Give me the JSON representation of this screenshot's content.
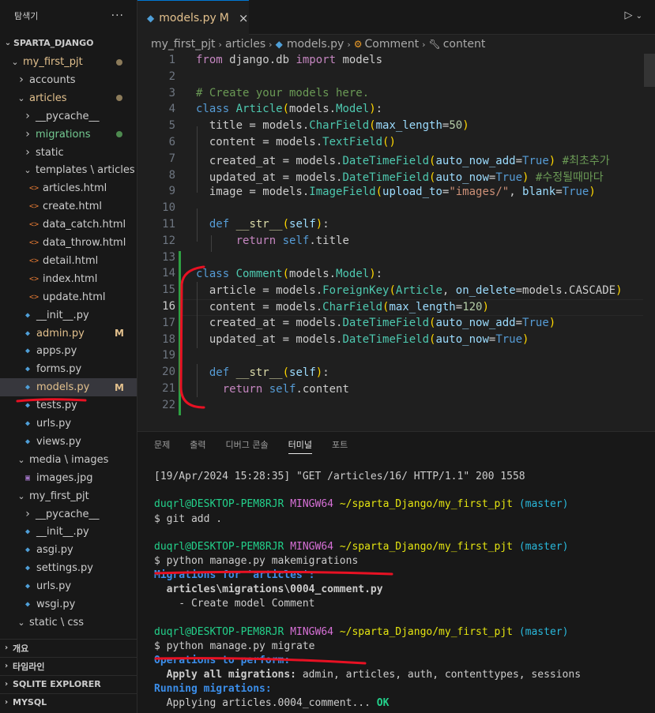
{
  "explorer": {
    "title": "탐색기",
    "more_icon": "ellipsis-icon",
    "project": "SPARTA_DJANGO",
    "items": [
      {
        "label": "my_first_pjt",
        "kind": "folder-open",
        "dot": "modified"
      },
      {
        "label": "accounts",
        "kind": "folder-closed"
      },
      {
        "label": "articles",
        "kind": "folder-open",
        "dot": "modified"
      },
      {
        "label": "__pycache__",
        "kind": "folder-closed"
      },
      {
        "label": "migrations",
        "kind": "folder-closed",
        "dot": "untracked"
      },
      {
        "label": "static",
        "kind": "folder-closed"
      },
      {
        "label": "templates \\ articles",
        "kind": "folder-open"
      },
      {
        "label": "articles.html",
        "kind": "html"
      },
      {
        "label": "create.html",
        "kind": "html"
      },
      {
        "label": "data_catch.html",
        "kind": "html"
      },
      {
        "label": "data_throw.html",
        "kind": "html"
      },
      {
        "label": "detail.html",
        "kind": "html"
      },
      {
        "label": "index.html",
        "kind": "html"
      },
      {
        "label": "update.html",
        "kind": "html"
      },
      {
        "label": "__init__.py",
        "kind": "py"
      },
      {
        "label": "admin.py",
        "kind": "py",
        "badge": "M"
      },
      {
        "label": "apps.py",
        "kind": "py"
      },
      {
        "label": "forms.py",
        "kind": "py"
      },
      {
        "label": "models.py",
        "kind": "py",
        "badge": "M",
        "selected": true
      },
      {
        "label": "tests.py",
        "kind": "py"
      },
      {
        "label": "urls.py",
        "kind": "py"
      },
      {
        "label": "views.py",
        "kind": "py"
      },
      {
        "label": "media \\ images",
        "kind": "folder-open"
      },
      {
        "label": "images.jpg",
        "kind": "img"
      },
      {
        "label": "my_first_pjt",
        "kind": "folder-open"
      },
      {
        "label": "__pycache__",
        "kind": "folder-closed"
      },
      {
        "label": "__init__.py",
        "kind": "py"
      },
      {
        "label": "asgi.py",
        "kind": "py"
      },
      {
        "label": "settings.py",
        "kind": "py"
      },
      {
        "label": "urls.py",
        "kind": "py"
      },
      {
        "label": "wsgi.py",
        "kind": "py"
      },
      {
        "label": "static \\ css",
        "kind": "folder-open"
      }
    ],
    "sections": [
      "개요",
      "타임라인",
      "SQLITE EXPLORER",
      "MYSQL"
    ]
  },
  "tab": {
    "label": "models.py",
    "badge": "M",
    "close": "×"
  },
  "breadcrumb": {
    "parts": [
      "my_first_pjt",
      "articles",
      "models.py",
      "Comment",
      "content"
    ]
  },
  "editor": {
    "active_line": 16,
    "line_numbers": [
      "1",
      "2",
      "3",
      "4",
      "5",
      "6",
      "7",
      "8",
      "9",
      "10",
      "11",
      "12",
      "13",
      "14",
      "15",
      "16",
      "17",
      "18",
      "19",
      "20",
      "21",
      "22"
    ]
  },
  "panel": {
    "tabs": [
      "문제",
      "출력",
      "디버그 콘솔",
      "터미널",
      "포트"
    ],
    "active_tab": "터미널"
  },
  "terminal": {
    "log_line": "[19/Apr/2024 15:28:35] \"GET /articles/16/ HTTP/1.1\" 200 1558",
    "prompt_user": "duqrl@DESKTOP-PEM8RJR",
    "prompt_env": "MINGW64",
    "prompt_path": "~/sparta_Django/my_first_pjt",
    "prompt_branch": "(master)",
    "cmd1": "$ git add .",
    "cmd2": "$ python manage.py makemigrations",
    "mig_header": "Migrations for 'articles':",
    "mig_file": "  articles\\migrations\\0004_comment.py",
    "mig_create": "    - Create model Comment",
    "cmd3": "$ python manage.py migrate",
    "ops_header": "Operations to perform:",
    "apply_label": "  Apply all migrations:",
    "apply_list": " admin, articles, auth, contenttypes, sessions",
    "running": "Running migrations:",
    "applying": "  Applying articles.0004_comment...",
    "ok": " OK"
  },
  "colors": {
    "annotation": "#e81123",
    "accent": "#0078d4",
    "modified": "#e2c08d"
  }
}
